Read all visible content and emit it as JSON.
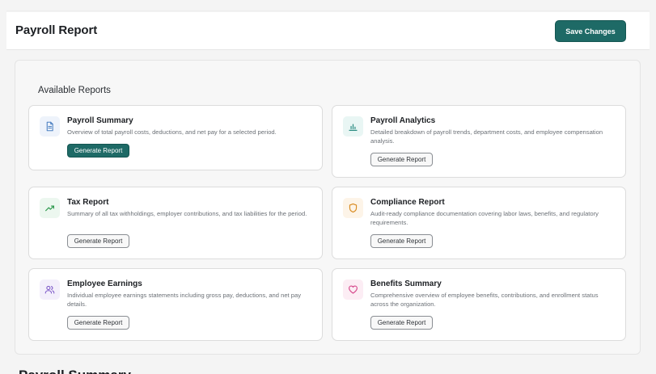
{
  "header": {
    "title": "Payroll Report",
    "save_label": "Save Changes"
  },
  "panel": {
    "title": "Available Reports"
  },
  "reports": [
    {
      "title": "Payroll Summary",
      "description": "Overview of total payroll costs, deductions, and net pay for a selected period.",
      "button_label": "Generate Report",
      "icon": "document-icon",
      "active": true
    },
    {
      "title": "Payroll Analytics",
      "description": "Detailed breakdown of payroll trends, department costs, and employee compensation analysis.",
      "button_label": "Generate Report",
      "icon": "bar-chart-icon",
      "active": false
    },
    {
      "title": "Tax Report",
      "description": "Summary of all tax withholdings, employer contributions, and tax liabilities for the period.",
      "button_label": "Generate Report",
      "icon": "trending-up-icon",
      "active": false
    },
    {
      "title": "Compliance Report",
      "description": "Audit-ready compliance documentation covering labor laws, benefits, and regulatory requirements.",
      "button_label": "Generate Report",
      "icon": "shield-icon",
      "active": false
    },
    {
      "title": "Employee Earnings",
      "description": "Individual employee earnings statements including gross pay, deductions, and net pay details.",
      "button_label": "Generate Report",
      "icon": "users-icon",
      "active": false
    },
    {
      "title": "Benefits Summary",
      "description": "Comprehensive overview of employee benefits, contributions, and enrollment status across the organization.",
      "button_label": "Generate Report",
      "icon": "heart-icon",
      "active": false
    }
  ],
  "next_section": {
    "title": "Payroll Summary"
  },
  "colors": {
    "accent": "#1e6a66",
    "icon_document": "#4a7fc1",
    "icon_chart": "#2b8c82",
    "icon_trending": "#2f9a4f",
    "icon_shield": "#d98a1f",
    "icon_users": "#7d58c8",
    "icon_heart": "#d6458a"
  }
}
